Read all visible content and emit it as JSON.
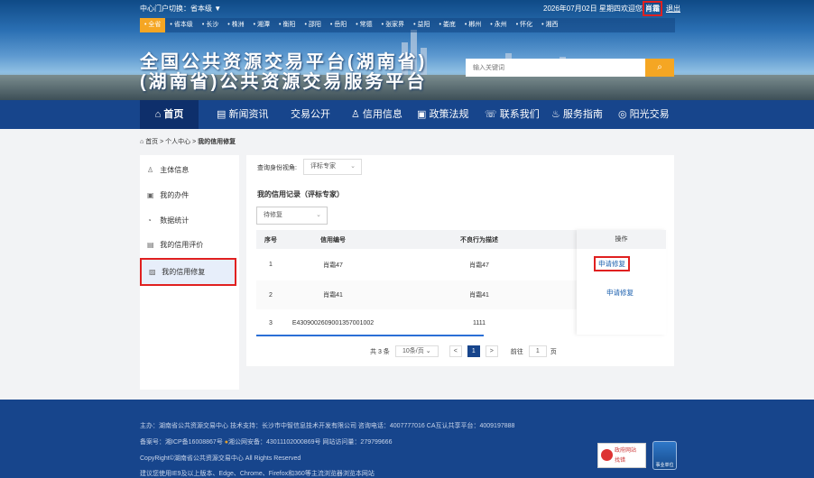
{
  "header": {
    "switch_label": "中心门户切换：省本级 ▼",
    "date": "2026年07月02日 星期四",
    "welcome": "欢迎您,",
    "user": "肖霜",
    "logout": "退出",
    "cities": [
      "全省",
      "省本级",
      "长沙",
      "株洲",
      "湘潭",
      "衡阳",
      "邵阳",
      "岳阳",
      "常德",
      "张家界",
      "益阳",
      "娄底",
      "郴州",
      "永州",
      "怀化",
      "湘西"
    ],
    "title_line1": "全国公共资源交易平台(湖南省)",
    "title_line2": "(湖南省)公共资源交易服务平台",
    "search_placeholder": "输入关键词",
    "search_icon": "search-icon"
  },
  "nav": {
    "items": [
      "⌂ 首页",
      "▤ 新闻资讯",
      "交易公开",
      "♙ 信用信息",
      "▣ 政策法规",
      "☏ 联系我们",
      "♨ 服务指南",
      "◎ 阳光交易"
    ]
  },
  "breadcrumb": {
    "home": "首页",
    "sep1": " > ",
    "center": "个人中心",
    "sep2": " > ",
    "current": "我的信用修复"
  },
  "sidebar": {
    "items": [
      {
        "icon": "person-icon",
        "glyph": "♙",
        "label": "主体信息"
      },
      {
        "icon": "briefcase-icon",
        "glyph": "▣",
        "label": "我的办件"
      },
      {
        "icon": "clock-chart-icon",
        "glyph": "◔",
        "label": "数据统计"
      },
      {
        "icon": "rating-icon",
        "glyph": "▤",
        "label": "我的信用评价"
      },
      {
        "icon": "repair-icon",
        "glyph": "▨",
        "label": "我的信用修复"
      }
    ]
  },
  "main": {
    "role_label": "查询身份视角:",
    "role_value": "评标专家",
    "record_title": "我的信用记录（评标专家）",
    "status_value": "待修复",
    "columns": [
      "序号",
      "信用编号",
      "不良行为描述",
      "操作"
    ],
    "rows": [
      {
        "no": "1",
        "code": "肖霜47",
        "desc": "肖霜47",
        "op": "申请修复"
      },
      {
        "no": "2",
        "code": "肖霜41",
        "desc": "肖霜41",
        "op": "申请修复"
      },
      {
        "no": "3",
        "code": "E4309002609001357001002",
        "desc": "1111",
        "op": ""
      }
    ],
    "pager": {
      "total": "共 3 条",
      "page_size": "10条/页",
      "prev": "<",
      "current": "1",
      "next": ">",
      "goto_label": "前往",
      "goto_value": "1",
      "page_unit": "页"
    }
  },
  "footer": {
    "line1": "主办：湖南省公共资源交易中心   技术支持：长沙市中智信息技术开发有限公司   咨询电话：4007777016   CA互认共享平台：4009197888",
    "line2a": "备案号：湘ICP备16008867号",
    "line2b": "湘公网安备：43011102000869号 网站访问量：279799666",
    "line3": "CopyRight©湖南省公共资源交易中心 All Rights Reserved",
    "line4": "建议您使用IE9及以上版本、Edge、Chrome、Firefox和360等主流浏览器浏览本网站",
    "badge1_top": "政府网站",
    "badge1_bottom": "找错",
    "badge2": "事业单位"
  }
}
